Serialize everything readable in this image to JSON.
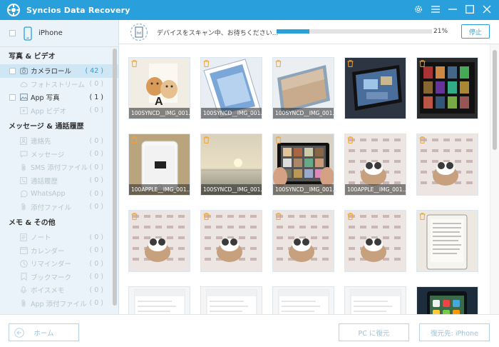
{
  "app": {
    "title": "Syncios Data Recovery"
  },
  "colors": {
    "accent": "#29a0dc",
    "sidebar_bg": "#e9f3f9",
    "disabled_text": "#b7c5cf"
  },
  "device": {
    "label": "iPhone"
  },
  "sidebar": {
    "sections": [
      {
        "title": "写真 & ビデオ",
        "items": [
          {
            "label": "カメラロール",
            "count": "( 42 )",
            "icon": "camera-icon",
            "state": "active"
          },
          {
            "label": "フォトストリーム",
            "count": "( 0 )",
            "icon": "cloud-icon",
            "state": "disabled"
          },
          {
            "label": "App 写真",
            "count": "( 1 )",
            "icon": "photo-icon",
            "state": "normal"
          },
          {
            "label": "App ビデオ",
            "count": "( 0 )",
            "icon": "video-icon",
            "state": "disabled"
          }
        ]
      },
      {
        "title": "メッセージ & 通話履歴",
        "items": [
          {
            "label": "連絡先",
            "count": "( 0 )",
            "icon": "contacts-icon",
            "state": "disabled"
          },
          {
            "label": "メッセージ",
            "count": "( 0 )",
            "icon": "message-icon",
            "state": "disabled"
          },
          {
            "label": "SMS 添付ファイル",
            "count": "( 0 )",
            "icon": "attachment-icon",
            "state": "disabled"
          },
          {
            "label": "通話履歴",
            "count": "( 0 )",
            "icon": "phone-icon",
            "state": "disabled"
          },
          {
            "label": "WhatsApp",
            "count": "( 0 )",
            "icon": "whatsapp-icon",
            "state": "disabled"
          },
          {
            "label": "添付ファイル",
            "count": "( 0 )",
            "icon": "attachment-icon",
            "state": "disabled"
          }
        ]
      },
      {
        "title": "メモ & その他",
        "items": [
          {
            "label": "ノート",
            "count": "( 0 )",
            "icon": "note-icon",
            "state": "disabled"
          },
          {
            "label": "カレンダー",
            "count": "( 0 )",
            "icon": "calendar-icon",
            "state": "disabled"
          },
          {
            "label": "リマインダー",
            "count": "( 0 )",
            "icon": "reminder-icon",
            "state": "disabled"
          },
          {
            "label": "ブックマーク",
            "count": "( 0 )",
            "icon": "bookmark-icon",
            "state": "disabled"
          },
          {
            "label": "ボイスメモ",
            "count": "( 0 )",
            "icon": "voice-memo-icon",
            "state": "disabled"
          },
          {
            "label": "App 添付ファイル",
            "count": "( 0 )",
            "icon": "attachment-icon",
            "state": "disabled"
          }
        ]
      }
    ]
  },
  "scan": {
    "text": "デバイスをスキャン中、お待ちください...",
    "progress_percent": 21,
    "percent_label": "21%",
    "stop_label": "停止"
  },
  "photos": [
    {
      "caption": "100SYNCD__IMG_001...",
      "kind": "kittens"
    },
    {
      "caption": "100SYNCD__IMG_001...",
      "kind": "ipad-angle"
    },
    {
      "caption": "100SYNCD__IMG_001...",
      "kind": "ipad-flat"
    },
    {
      "caption": "",
      "kind": "ipad-dark"
    },
    {
      "caption": "",
      "kind": "movie-grid"
    },
    {
      "caption": "100APPLE__IMG_001...",
      "kind": "iphone-white"
    },
    {
      "caption": "100SYNCD__IMG_001...",
      "kind": "sunset"
    },
    {
      "caption": "100SYNCD__IMG_001...",
      "kind": "ipad-hands"
    },
    {
      "caption": "100APPLE__IMG_001...",
      "kind": "calendar"
    },
    {
      "caption": "",
      "kind": "calendar"
    },
    {
      "caption": "",
      "kind": "calendar"
    },
    {
      "caption": "",
      "kind": "calendar"
    },
    {
      "caption": "",
      "kind": "calendar"
    },
    {
      "caption": "",
      "kind": "calendar"
    },
    {
      "caption": "",
      "kind": "ereader"
    },
    {
      "caption": "",
      "kind": "settings"
    },
    {
      "caption": "",
      "kind": "settings"
    },
    {
      "caption": "",
      "kind": "settings"
    },
    {
      "caption": "",
      "kind": "settings"
    },
    {
      "caption": "",
      "kind": "homescreen"
    }
  ],
  "bottom": {
    "home_label": "ホーム",
    "recover_pc_label": "PC に復元",
    "recover_iphone_label": "復元先: iPhone"
  }
}
